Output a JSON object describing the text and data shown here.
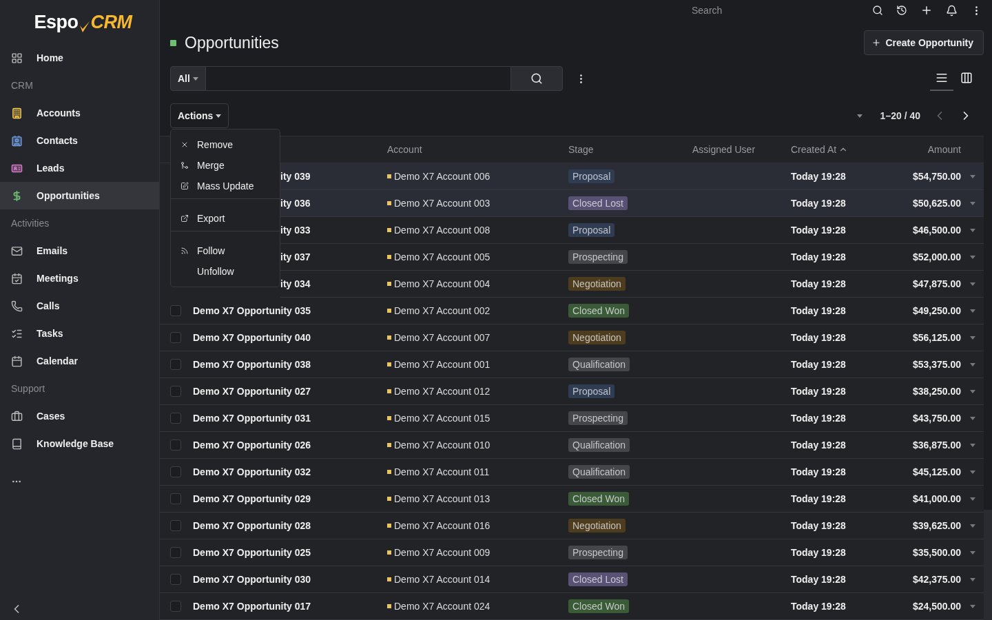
{
  "logo": {
    "part1": "Espo",
    "part2": "CRM"
  },
  "sidebar": {
    "groups": [
      {
        "items": [
          {
            "label": "Home",
            "selected": false
          }
        ]
      },
      {
        "title": "CRM",
        "items": [
          {
            "label": "Accounts",
            "selected": false
          },
          {
            "label": "Contacts",
            "selected": false
          },
          {
            "label": "Leads",
            "selected": false
          },
          {
            "label": "Opportunities",
            "selected": true
          }
        ]
      },
      {
        "title": "Activities",
        "items": [
          {
            "label": "Emails",
            "selected": false
          },
          {
            "label": "Meetings",
            "selected": false
          },
          {
            "label": "Calls",
            "selected": false
          },
          {
            "label": "Tasks",
            "selected": false
          },
          {
            "label": "Calendar",
            "selected": false
          }
        ]
      },
      {
        "title": "Support",
        "items": [
          {
            "label": "Cases",
            "selected": false
          },
          {
            "label": "Knowledge Base",
            "selected": false
          }
        ]
      }
    ]
  },
  "topbar": {
    "search_placeholder": "Search"
  },
  "page": {
    "title": "Opportunities",
    "create_button": "Create Opportunity"
  },
  "filter": {
    "preset": "All"
  },
  "views": [
    {
      "kind": "list",
      "selected": true
    },
    {
      "kind": "kanban",
      "selected": false
    }
  ],
  "actions": {
    "label": "Actions",
    "expanded": true,
    "menu": [
      [
        {
          "label": "Remove"
        },
        {
          "label": "Merge"
        },
        {
          "label": "Mass Update"
        }
      ],
      [
        {
          "label": "Export"
        }
      ],
      [
        {
          "label": "Follow"
        },
        {
          "label": "Unfollow"
        }
      ]
    ]
  },
  "pagination": {
    "range": "1–20 / 40",
    "prev_disabled": true
  },
  "table": {
    "columns": [
      {
        "label": "Account"
      },
      {
        "label": "Stage"
      },
      {
        "label": "Assigned User"
      },
      {
        "label": "Created At",
        "sorted": true
      },
      {
        "label": "Amount"
      }
    ],
    "rows": [
      {
        "name": "ity 039",
        "under_menu": true,
        "selected": true,
        "account": "Demo X7 Account 006",
        "stage": {
          "label": "Proposal",
          "color": "#2f3c52"
        },
        "created": "Today 19:28",
        "amount": "$54,750.00"
      },
      {
        "name": "ity 036",
        "under_menu": true,
        "selected": true,
        "account": "Demo X7 Account 003",
        "stage": {
          "label": "Closed Lost",
          "color": "#5a5275"
        },
        "created": "Today 19:28",
        "amount": "$50,625.00"
      },
      {
        "name": "ity 033",
        "under_menu": true,
        "selected": false,
        "account": "Demo X7 Account 008",
        "stage": {
          "label": "Proposal",
          "color": "#2f3c52"
        },
        "created": "Today 19:28",
        "amount": "$46,500.00"
      },
      {
        "name": "ity 037",
        "under_menu": true,
        "selected": false,
        "account": "Demo X7 Account 005",
        "stage": {
          "label": "Prospecting",
          "color": "#45464a"
        },
        "created": "Today 19:28",
        "amount": "$52,000.00"
      },
      {
        "name": "ity 034",
        "under_menu": true,
        "selected": false,
        "account": "Demo X7 Account 004",
        "stage": {
          "label": "Negotiation",
          "color": "#4d3d1e"
        },
        "created": "Today 19:28",
        "amount": "$47,875.00"
      },
      {
        "name": "Demo X7 Opportunity 035",
        "under_menu": false,
        "selected": false,
        "checked": false,
        "account": "Demo X7 Account 002",
        "stage": {
          "label": "Closed Won",
          "color": "#3b5a38"
        },
        "created": "Today 19:28",
        "amount": "$49,250.00"
      },
      {
        "name": "Demo X7 Opportunity 040",
        "under_menu": false,
        "selected": false,
        "checked": false,
        "account": "Demo X7 Account 007",
        "stage": {
          "label": "Negotiation",
          "color": "#4d3d1e"
        },
        "created": "Today 19:28",
        "amount": "$56,125.00"
      },
      {
        "name": "Demo X7 Opportunity 038",
        "under_menu": false,
        "selected": false,
        "checked": false,
        "account": "Demo X7 Account 001",
        "stage": {
          "label": "Qualification",
          "color": "#45464a"
        },
        "created": "Today 19:28",
        "amount": "$53,375.00"
      },
      {
        "name": "Demo X7 Opportunity 027",
        "under_menu": false,
        "selected": false,
        "checked": false,
        "account": "Demo X7 Account 012",
        "stage": {
          "label": "Proposal",
          "color": "#2f3c52"
        },
        "created": "Today 19:28",
        "amount": "$38,250.00"
      },
      {
        "name": "Demo X7 Opportunity 031",
        "under_menu": false,
        "selected": false,
        "checked": false,
        "account": "Demo X7 Account 015",
        "stage": {
          "label": "Prospecting",
          "color": "#45464a"
        },
        "created": "Today 19:28",
        "amount": "$43,750.00"
      },
      {
        "name": "Demo X7 Opportunity 026",
        "under_menu": false,
        "selected": false,
        "checked": false,
        "account": "Demo X7 Account 010",
        "stage": {
          "label": "Qualification",
          "color": "#45464a"
        },
        "created": "Today 19:28",
        "amount": "$36,875.00"
      },
      {
        "name": "Demo X7 Opportunity 032",
        "under_menu": false,
        "selected": false,
        "checked": false,
        "account": "Demo X7 Account 011",
        "stage": {
          "label": "Qualification",
          "color": "#45464a"
        },
        "created": "Today 19:28",
        "amount": "$45,125.00"
      },
      {
        "name": "Demo X7 Opportunity 029",
        "under_menu": false,
        "selected": false,
        "checked": false,
        "account": "Demo X7 Account 013",
        "stage": {
          "label": "Closed Won",
          "color": "#3b5a38"
        },
        "created": "Today 19:28",
        "amount": "$41,000.00"
      },
      {
        "name": "Demo X7 Opportunity 028",
        "under_menu": false,
        "selected": false,
        "checked": false,
        "account": "Demo X7 Account 016",
        "stage": {
          "label": "Negotiation",
          "color": "#4d3d1e"
        },
        "created": "Today 19:28",
        "amount": "$39,625.00"
      },
      {
        "name": "Demo X7 Opportunity 025",
        "under_menu": false,
        "selected": false,
        "checked": false,
        "account": "Demo X7 Account 009",
        "stage": {
          "label": "Prospecting",
          "color": "#45464a"
        },
        "created": "Today 19:28",
        "amount": "$35,500.00"
      },
      {
        "name": "Demo X7 Opportunity 030",
        "under_menu": false,
        "selected": false,
        "checked": false,
        "account": "Demo X7 Account 014",
        "stage": {
          "label": "Closed Lost",
          "color": "#5a5275"
        },
        "created": "Today 19:28",
        "amount": "$42,375.00"
      },
      {
        "name": "Demo X7 Opportunity 017",
        "under_menu": false,
        "selected": false,
        "checked": false,
        "account": "Demo X7 Account 024",
        "stage": {
          "label": "Closed Won",
          "color": "#3b5a38"
        },
        "created": "Today 19:28",
        "amount": "$24,500.00"
      }
    ]
  }
}
